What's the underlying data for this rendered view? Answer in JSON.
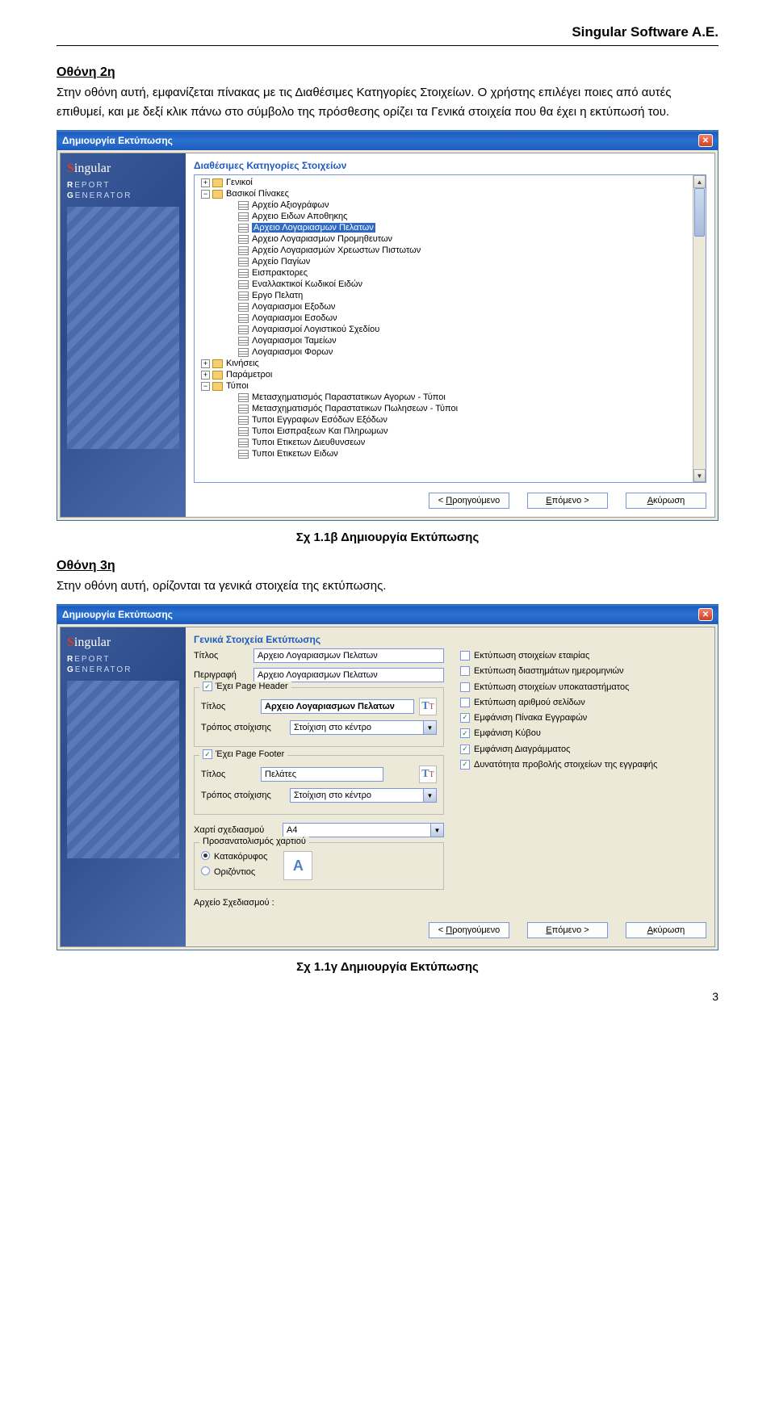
{
  "header": {
    "company": "Singular Software A.E."
  },
  "sec2": {
    "title": "Οθόνη 2η",
    "para": "Στην οθόνη αυτή, εμφανίζεται πίνακας με τις Διαθέσιμες Κατηγορίες Στοιχείων. Ο χρήστης επιλέγει ποιες από αυτές επιθυμεί, και με δεξί κλικ πάνω στο σύμβολο της πρόσθεσης ορίζει τα Γενικά στοιχεία που θα έχει η εκτύπωσή του."
  },
  "dialog": {
    "title": "Δημιουργία Εκτύπωσης",
    "brand": "Singular",
    "brand_sub1": "REPORT",
    "brand_sub2": "GENERATOR",
    "heading1": "Διαθέσιμες Κατηγορίες Στοιχείων",
    "tree": {
      "n_genikoi": "Γενικοί",
      "n_basikoi": "Βασικοί Πίνακες",
      "leaves": [
        "Αρχείο Αξιογράφων",
        "Αρχειο Ειδων Αποθηκης",
        "Αρχειο Λογαριασμων Πελατων",
        "Αρχειο Λογαριασμων Προμηθευτων",
        "Αρχείο Λογαριασμών Χρεωστων Πιστωτων",
        "Αρχείο Παγίων",
        "Εισπρακτορες",
        "Εναλλακτικοί Κωδικοί Ειδών",
        "Εργο Πελατη",
        "Λογαριασμοι Εξοδων",
        "Λογαριασμοι Εσοδων",
        "Λογαριασμοί Λογιστικού Σχεδίου",
        "Λογαριασμοι Ταμείων",
        "Λογαριασμοι Φορων"
      ],
      "selected_index": 2,
      "n_kiniseis": "Κινήσεις",
      "n_param": "Παράμετροι",
      "n_typoi": "Τύποι",
      "typoi_leaves": [
        "Μετασχηματισμός  Παραστατικων Αγορων - Τύποι",
        "Μετασχηματισμός Παραστατικων Πωλησεων - Τύποι",
        "Τυποι Εγγραφων Εσόδων Εξόδων",
        "Τυποι Εισπραξεων Και Πληρωμων",
        "Τυποι Ετικετων Διευθυνσεων",
        "Τυποι Ετικετων Ειδων"
      ]
    },
    "btn_prev": "Προηγούμενο",
    "btn_next": "Επόμενο",
    "btn_cancel": "Ακύρωση",
    "btn_prev_u": "Π",
    "btn_next_u": "Ε",
    "btn_cancel_u": "Α"
  },
  "caption1": "Σχ 1.1β Δημιουργία Εκτύπωσης",
  "sec3": {
    "title": "Οθόνη 3η",
    "para": "Στην οθόνη αυτή, ορίζονται τα γενικά στοιχεία της εκτύπωσης."
  },
  "dialog2": {
    "heading": "Γενικά Στοιχεία Εκτύπωσης",
    "lbl_titlos": "Τίτλος",
    "val_titlos": "Αρχειο Λογαριασμων Πελατων",
    "lbl_perigrafi": "Περιγραφή",
    "val_perigrafi": "Αρχειο Λογαριασμων Πελατων",
    "fs_header": "Έχει Page Header",
    "fs_header_title_val": "Αρχειο Λογαριασμων Πελατων",
    "lbl_tropos": "Τρόπος στοίχισης",
    "val_tropos": "Στοίχιση στο κέντρο",
    "fs_footer": "Έχει Page Footer",
    "fs_footer_title_val": "Πελάτες",
    "lbl_xarti": "Χαρτί σχεδιασμού",
    "val_xarti": "A4",
    "fs_orient": "Προσανατολισμός χαρτιού",
    "opt_portrait": "Κατακόρυφος",
    "opt_landscape": "Οριζόντιος",
    "lbl_arxeio": "Αρχείο Σχεδιασμού :",
    "checks": [
      {
        "label": "Εκτύπωση στοιχείων εταιρίας",
        "checked": false
      },
      {
        "label": "Εκτύπωση διαστημάτων ημερομηνιών",
        "checked": false
      },
      {
        "label": "Εκτύπωση στοιχείων υποκαταστήματος",
        "checked": false
      },
      {
        "label": "Εκτύπωση αριθμού σελίδων",
        "checked": false
      },
      {
        "label": "Εμφάνιση Πίνακα Εγγραφών",
        "checked": true
      },
      {
        "label": "Εμφάνιση Κύβου",
        "checked": true
      },
      {
        "label": "Εμφάνιση Διαγράμματος",
        "checked": true
      },
      {
        "label": "Δυνατότητα προβολής στοιχείων της εγγραφής",
        "checked": true
      }
    ]
  },
  "caption2": "Σχ 1.1γ Δημιουργία Εκτύπωσης",
  "page_num": "3"
}
